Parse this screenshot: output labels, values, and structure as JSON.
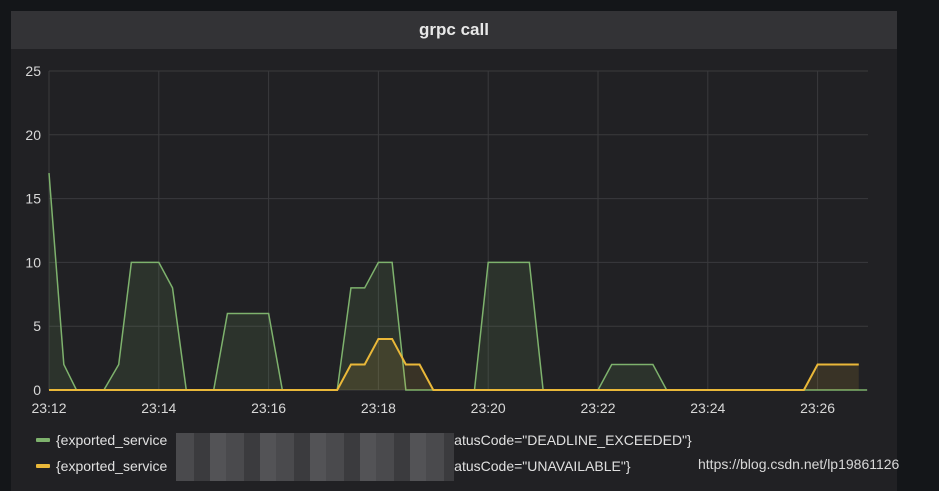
{
  "panel": {
    "title": "grpc call"
  },
  "chart_data": {
    "type": "line",
    "title": "grpc call",
    "xlabel": "",
    "ylabel": "",
    "ylim": [
      0,
      25
    ],
    "yticks": [
      "0",
      "5",
      "10",
      "15",
      "20",
      "25"
    ],
    "xlim_minutes_from_2312": [
      0,
      14.9
    ],
    "xticks": [
      "23:12",
      "23:14",
      "23:16",
      "23:18",
      "23:20",
      "23:22",
      "23:24",
      "23:26"
    ],
    "grid": true,
    "legend_placement": "bottom",
    "series": [
      {
        "name": "{exported_service",
        "suffix": "statusCode=\"DEADLINE_EXCEEDED\"}",
        "color": "#7eb26d",
        "points": [
          [
            0,
            17
          ],
          [
            0.27,
            2
          ],
          [
            0.5,
            0
          ],
          [
            1.0,
            0
          ],
          [
            1.27,
            2
          ],
          [
            1.5,
            10
          ],
          [
            2.0,
            10
          ],
          [
            2.25,
            8
          ],
          [
            2.5,
            0
          ],
          [
            3.0,
            0
          ],
          [
            3.25,
            6
          ],
          [
            4.0,
            6
          ],
          [
            4.25,
            0
          ],
          [
            5.25,
            0
          ],
          [
            5.5,
            8
          ],
          [
            5.75,
            8
          ],
          [
            6.0,
            10
          ],
          [
            6.25,
            10
          ],
          [
            6.5,
            0
          ],
          [
            7.75,
            0
          ],
          [
            8.0,
            10
          ],
          [
            8.75,
            10
          ],
          [
            9.0,
            0
          ],
          [
            10.0,
            0
          ],
          [
            10.25,
            2
          ],
          [
            11.0,
            2
          ],
          [
            11.25,
            0
          ],
          [
            14.9,
            0
          ]
        ]
      },
      {
        "name": "{exported_service",
        "suffix": "statusCode=\"UNAVAILABLE\"}",
        "color": "#eab839",
        "points": [
          [
            0,
            0
          ],
          [
            5.25,
            0
          ],
          [
            5.5,
            2
          ],
          [
            5.75,
            2
          ],
          [
            6.0,
            4
          ],
          [
            6.25,
            4
          ],
          [
            6.5,
            2
          ],
          [
            6.75,
            2
          ],
          [
            7.0,
            0
          ],
          [
            13.75,
            0
          ],
          [
            14.0,
            2
          ],
          [
            14.75,
            2
          ]
        ]
      }
    ]
  },
  "watermark": "https://blog.csdn.net/lp19861126"
}
